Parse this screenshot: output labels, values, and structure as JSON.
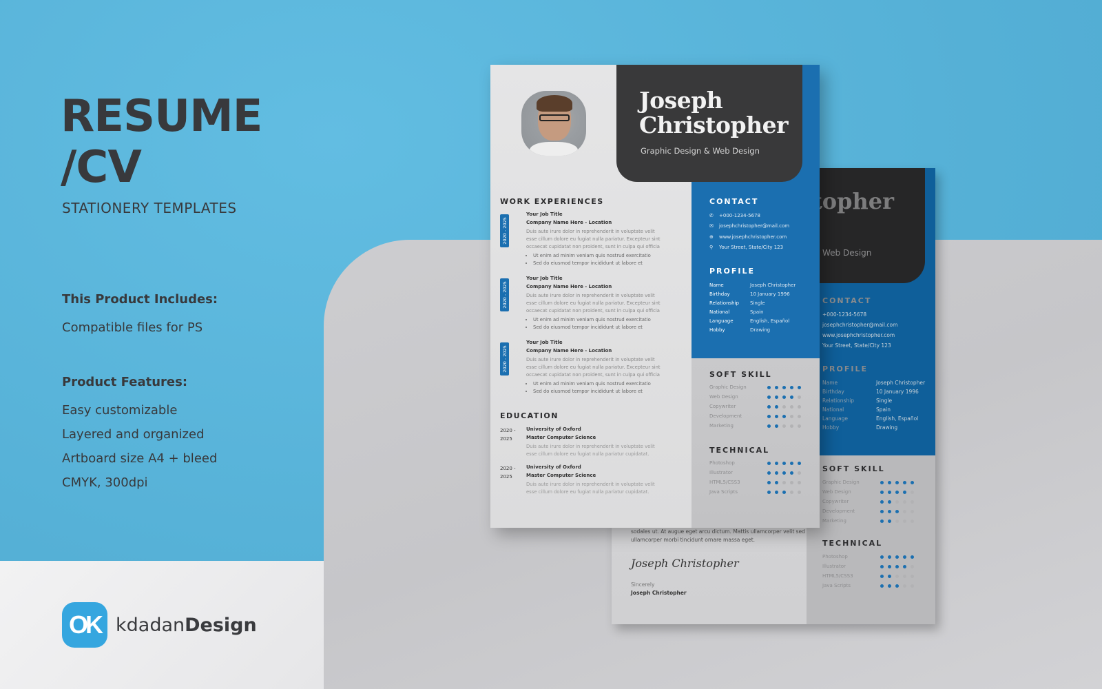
{
  "promo": {
    "title_line1": "RESUME",
    "title_line2": "/CV",
    "subtitle": "STATIONERY TEMPLATES",
    "includes_heading": "This Product Includes:",
    "includes_items": [
      "Compatible files for PS"
    ],
    "features_heading": "Product Features:",
    "features_items": [
      "Easy customizable",
      "Layered and organized",
      "Artboard size A4 + bleed",
      "CMYK, 300dpi"
    ],
    "brand": {
      "logo_text": "OK",
      "name_light": "kdadan",
      "name_bold": "Design"
    }
  },
  "colors": {
    "sky": "#5ab6da",
    "resume_blue": "#1b6fb0",
    "resume_dark": "#39393a",
    "brand_blue": "#35a6df",
    "text_dark": "#38393c"
  },
  "resume": {
    "first_name": "Joseph",
    "last_name": "Christopher",
    "role": "Graphic Design & Web Design",
    "work_title": "WORK EXPERIENCES",
    "jobs": [
      {
        "date": "2020 - 2025",
        "title": "Your Job Title",
        "company": "Company Name Here - Location",
        "desc": "Duis aute irure dolor in reprehenderit in voluptate velit esse cillum dolore eu fugiat nulla pariatur. Excepteur sint occaecat cupidatat non proident, sunt in culpa qui officia",
        "bullets": [
          "Ut enim ad minim veniam quis nostrud exercitatio",
          "Sed do eiusmod tempor incididunt ut labore et"
        ]
      },
      {
        "date": "2020 - 2025",
        "title": "Your Job Title",
        "company": "Company Name Here - Location",
        "desc": "Duis aute irure dolor in reprehenderit in voluptate velit esse cillum dolore eu fugiat nulla pariatur. Excepteur sint occaecat cupidatat non proident, sunt in culpa qui officia",
        "bullets": [
          "Ut enim ad minim veniam quis nostrud exercitatio",
          "Sed do eiusmod tempor incididunt ut labore et"
        ]
      },
      {
        "date": "2020 - 2025",
        "title": "Your Job Title",
        "company": "Company Name Here - Location",
        "desc": "Duis aute irure dolor in reprehenderit in voluptate velit esse cillum dolore eu fugiat nulla pariatur. Excepteur sint occaecat cupidatat non proident, sunt in culpa qui officia",
        "bullets": [
          "Ut enim ad minim veniam quis nostrud exercitatio",
          "Sed do eiusmod tempor incididunt ut labore et"
        ]
      }
    ],
    "education_title": "EDUCATION",
    "education": [
      {
        "years": "2020 - 2025",
        "school": "University of Oxford",
        "degree": "Master Computer Science",
        "desc": "Duis aute irure dolor in reprehenderit in voluptate velit esse cillum dolore eu fugiat nulla pariatur cupidatat."
      },
      {
        "years": "2020 - 2025",
        "school": "University of Oxford",
        "degree": "Master Computer Science",
        "desc": "Duis aute irure dolor in reprehenderit in voluptate velit esse cillum dolore eu fugiat nulla pariatur cupidatat."
      }
    ],
    "contact_title": "CONTACT",
    "contact": [
      {
        "icon": "phone-icon",
        "glyph": "✆",
        "value": "+000-1234-5678"
      },
      {
        "icon": "mail-icon",
        "glyph": "✉",
        "value": "josephchristopher@mail.com"
      },
      {
        "icon": "globe-icon",
        "glyph": "⊕",
        "value": "www.josephchristopher.com"
      },
      {
        "icon": "location-pin-icon",
        "glyph": "⚲",
        "value": "Your Street, State/City 123"
      }
    ],
    "profile_title": "PROFILE",
    "profile": [
      {
        "label": "Name",
        "value": "Joseph Christopher"
      },
      {
        "label": "Birthday",
        "value": "10 January 1996"
      },
      {
        "label": "Relationship",
        "value": "Single"
      },
      {
        "label": "National",
        "value": "Spain"
      },
      {
        "label": "Language",
        "value": "English, Español"
      },
      {
        "label": "Hobby",
        "value": "Drawing"
      }
    ],
    "soft_skill_title": "SOFT SKILL",
    "soft_skills": [
      {
        "name": "Graphic Design",
        "level": 5,
        "max": 5
      },
      {
        "name": "Web Design",
        "level": 4,
        "max": 5
      },
      {
        "name": "Copywriter",
        "level": 2,
        "max": 5
      },
      {
        "name": "Development",
        "level": 3,
        "max": 5
      },
      {
        "name": "Marketing",
        "level": 2,
        "max": 5
      }
    ],
    "technical_title": "TECHNICAL",
    "technical": [
      {
        "name": "Photoshop",
        "level": 5,
        "max": 5
      },
      {
        "name": "Illustrator",
        "level": 4,
        "max": 5
      },
      {
        "name": "HTML5/CSS3",
        "level": 2,
        "max": 5
      },
      {
        "name": "Java Scripts",
        "level": 3,
        "max": 5
      }
    ]
  },
  "cover_letter": {
    "name_fragment": "Christopher",
    "role_fragment": "Web Design",
    "body_excerpt": "lobortis scelerisque fermentum. Tincidunt arcu non sodales neque sodales ut. At augue eget arcu dictum. Mattis ullamcorper velit sed ullamcorper morbi tincidunt ornare massa eget.",
    "signature": "Joseph Christopher",
    "closing": "Sincerely",
    "signer": "Joseph Christopher"
  }
}
